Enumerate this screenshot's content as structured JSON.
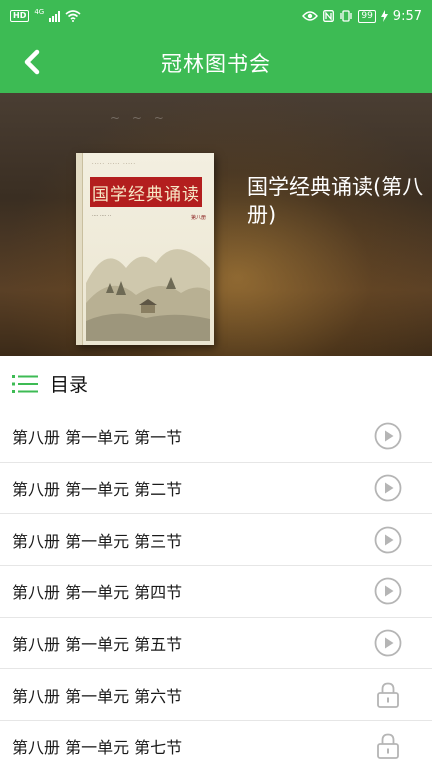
{
  "status_bar": {
    "hd": "HD",
    "network": "4G",
    "battery": "99",
    "time": "9:57"
  },
  "header": {
    "title": "冠林图书会"
  },
  "banner": {
    "cover_title": "国学经典诵读",
    "cover_volume": "第八册",
    "book_title": "国学经典诵读(第八册)"
  },
  "catalog": {
    "label": "目录"
  },
  "chapters": [
    {
      "label": "第八册 第一单元 第一节",
      "status": "play"
    },
    {
      "label": "第八册 第一单元 第二节",
      "status": "play"
    },
    {
      "label": "第八册 第一单元 第三节",
      "status": "play"
    },
    {
      "label": "第八册 第一单元 第四节",
      "status": "play"
    },
    {
      "label": "第八册 第一单元 第五节",
      "status": "play"
    },
    {
      "label": "第八册 第一单元 第六节",
      "status": "locked"
    },
    {
      "label": "第八册 第一单元 第七节",
      "status": "locked"
    }
  ],
  "colors": {
    "primary": "#3dbb54",
    "icon_gray": "#b5b5b5"
  }
}
